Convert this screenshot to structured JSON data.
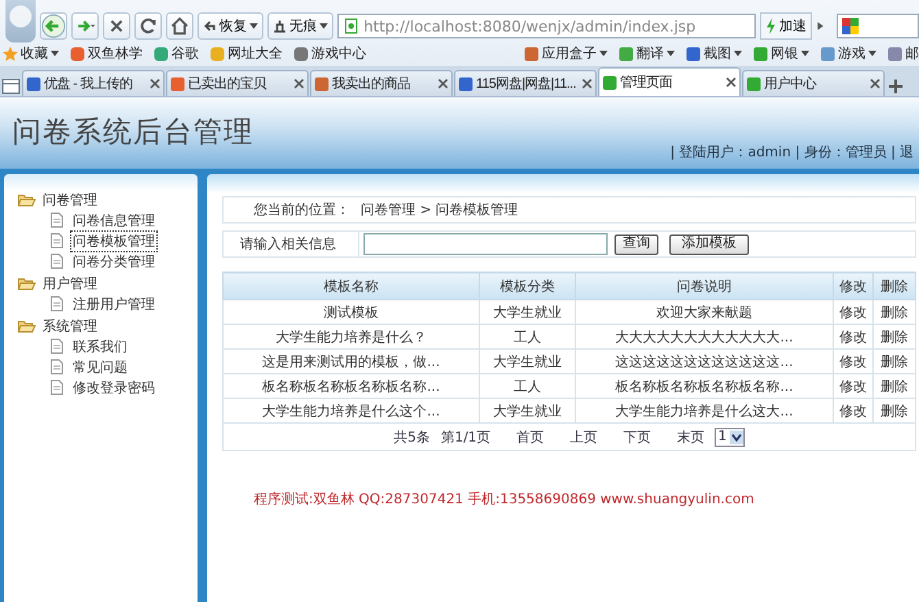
{
  "browser": {
    "nav_buttons": [
      {
        "kind": "back"
      },
      {
        "kind": "forward"
      },
      {
        "kind": "stop"
      },
      {
        "kind": "refresh"
      },
      {
        "kind": "home"
      }
    ],
    "menu_buttons": [
      "恢复",
      "无痕"
    ],
    "address": "http://localhost:8080/wenjx/admin/index.jsp",
    "speedup": "加速",
    "bookmarks": [
      "收藏",
      "双鱼林学",
      "谷歌",
      "网址大全",
      "游戏中心"
    ],
    "tools": [
      "应用盒子",
      "翻译",
      "截图",
      "网银",
      "游戏",
      "邮"
    ],
    "tabs": [
      {
        "label": "优盘 - 我上传的",
        "selected": false
      },
      {
        "label": "已卖出的宝贝",
        "selected": false
      },
      {
        "label": "我卖出的商品",
        "selected": false
      },
      {
        "label": "115网盘|网盘|11...",
        "selected": false
      },
      {
        "label": "管理页面",
        "selected": true
      },
      {
        "label": "用户中心",
        "selected": false
      }
    ]
  },
  "header": {
    "title": "问卷系统后台管理",
    "user_info": "| 登陆用户：admin | 身份：管理员 | 退"
  },
  "sidebar": {
    "groups": [
      {
        "label": "问卷管理",
        "children": [
          {
            "label": "问卷信息管理",
            "selected": false
          },
          {
            "label": "问卷模板管理",
            "selected": true
          },
          {
            "label": "问卷分类管理",
            "selected": false
          }
        ]
      },
      {
        "label": "用户管理",
        "children": [
          {
            "label": "注册用户管理",
            "selected": false
          }
        ]
      },
      {
        "label": "系统管理",
        "children": [
          {
            "label": "联系我们",
            "selected": false
          },
          {
            "label": "常见问题",
            "selected": false
          },
          {
            "label": "修改登录密码",
            "selected": false
          }
        ]
      }
    ]
  },
  "breadcrumb": {
    "prefix": "您当前的位置：",
    "path": "问卷管理 > 问卷模板管理"
  },
  "search": {
    "label": "请输入相关信息",
    "query_button": "查询",
    "add_button": "添加模板"
  },
  "table": {
    "columns": [
      "模板名称",
      "模板分类",
      "问卷说明",
      "修改",
      "删除"
    ],
    "rows": [
      [
        "测试模板",
        "大学生就业",
        "欢迎大家来献题",
        "修改",
        "删除"
      ],
      [
        "大学生能力培养是什么？",
        "工人",
        "大大大大大大大大大大大大...",
        "修改",
        "删除"
      ],
      [
        "这是用来测试用的模板，做...",
        "大学生就业",
        "这这这这这这这这这这这这...",
        "修改",
        "删除"
      ],
      [
        "板名称板名称板名称板名称...",
        "工人",
        "板名称板名称板名称板名称...",
        "修改",
        "删除"
      ],
      [
        "大学生能力培养是什么这个...",
        "大学生就业",
        "大学生能力培养是什么这大...",
        "修改",
        "删除"
      ]
    ]
  },
  "pagination": {
    "total": "共5条",
    "page": "第1/1页",
    "links": [
      "首页",
      "上页",
      "下页",
      "末页"
    ],
    "page_select": "1"
  },
  "footer": "程序测试:双鱼林 QQ:287307421 手机:13558690869 www.shuangyulin.com"
}
